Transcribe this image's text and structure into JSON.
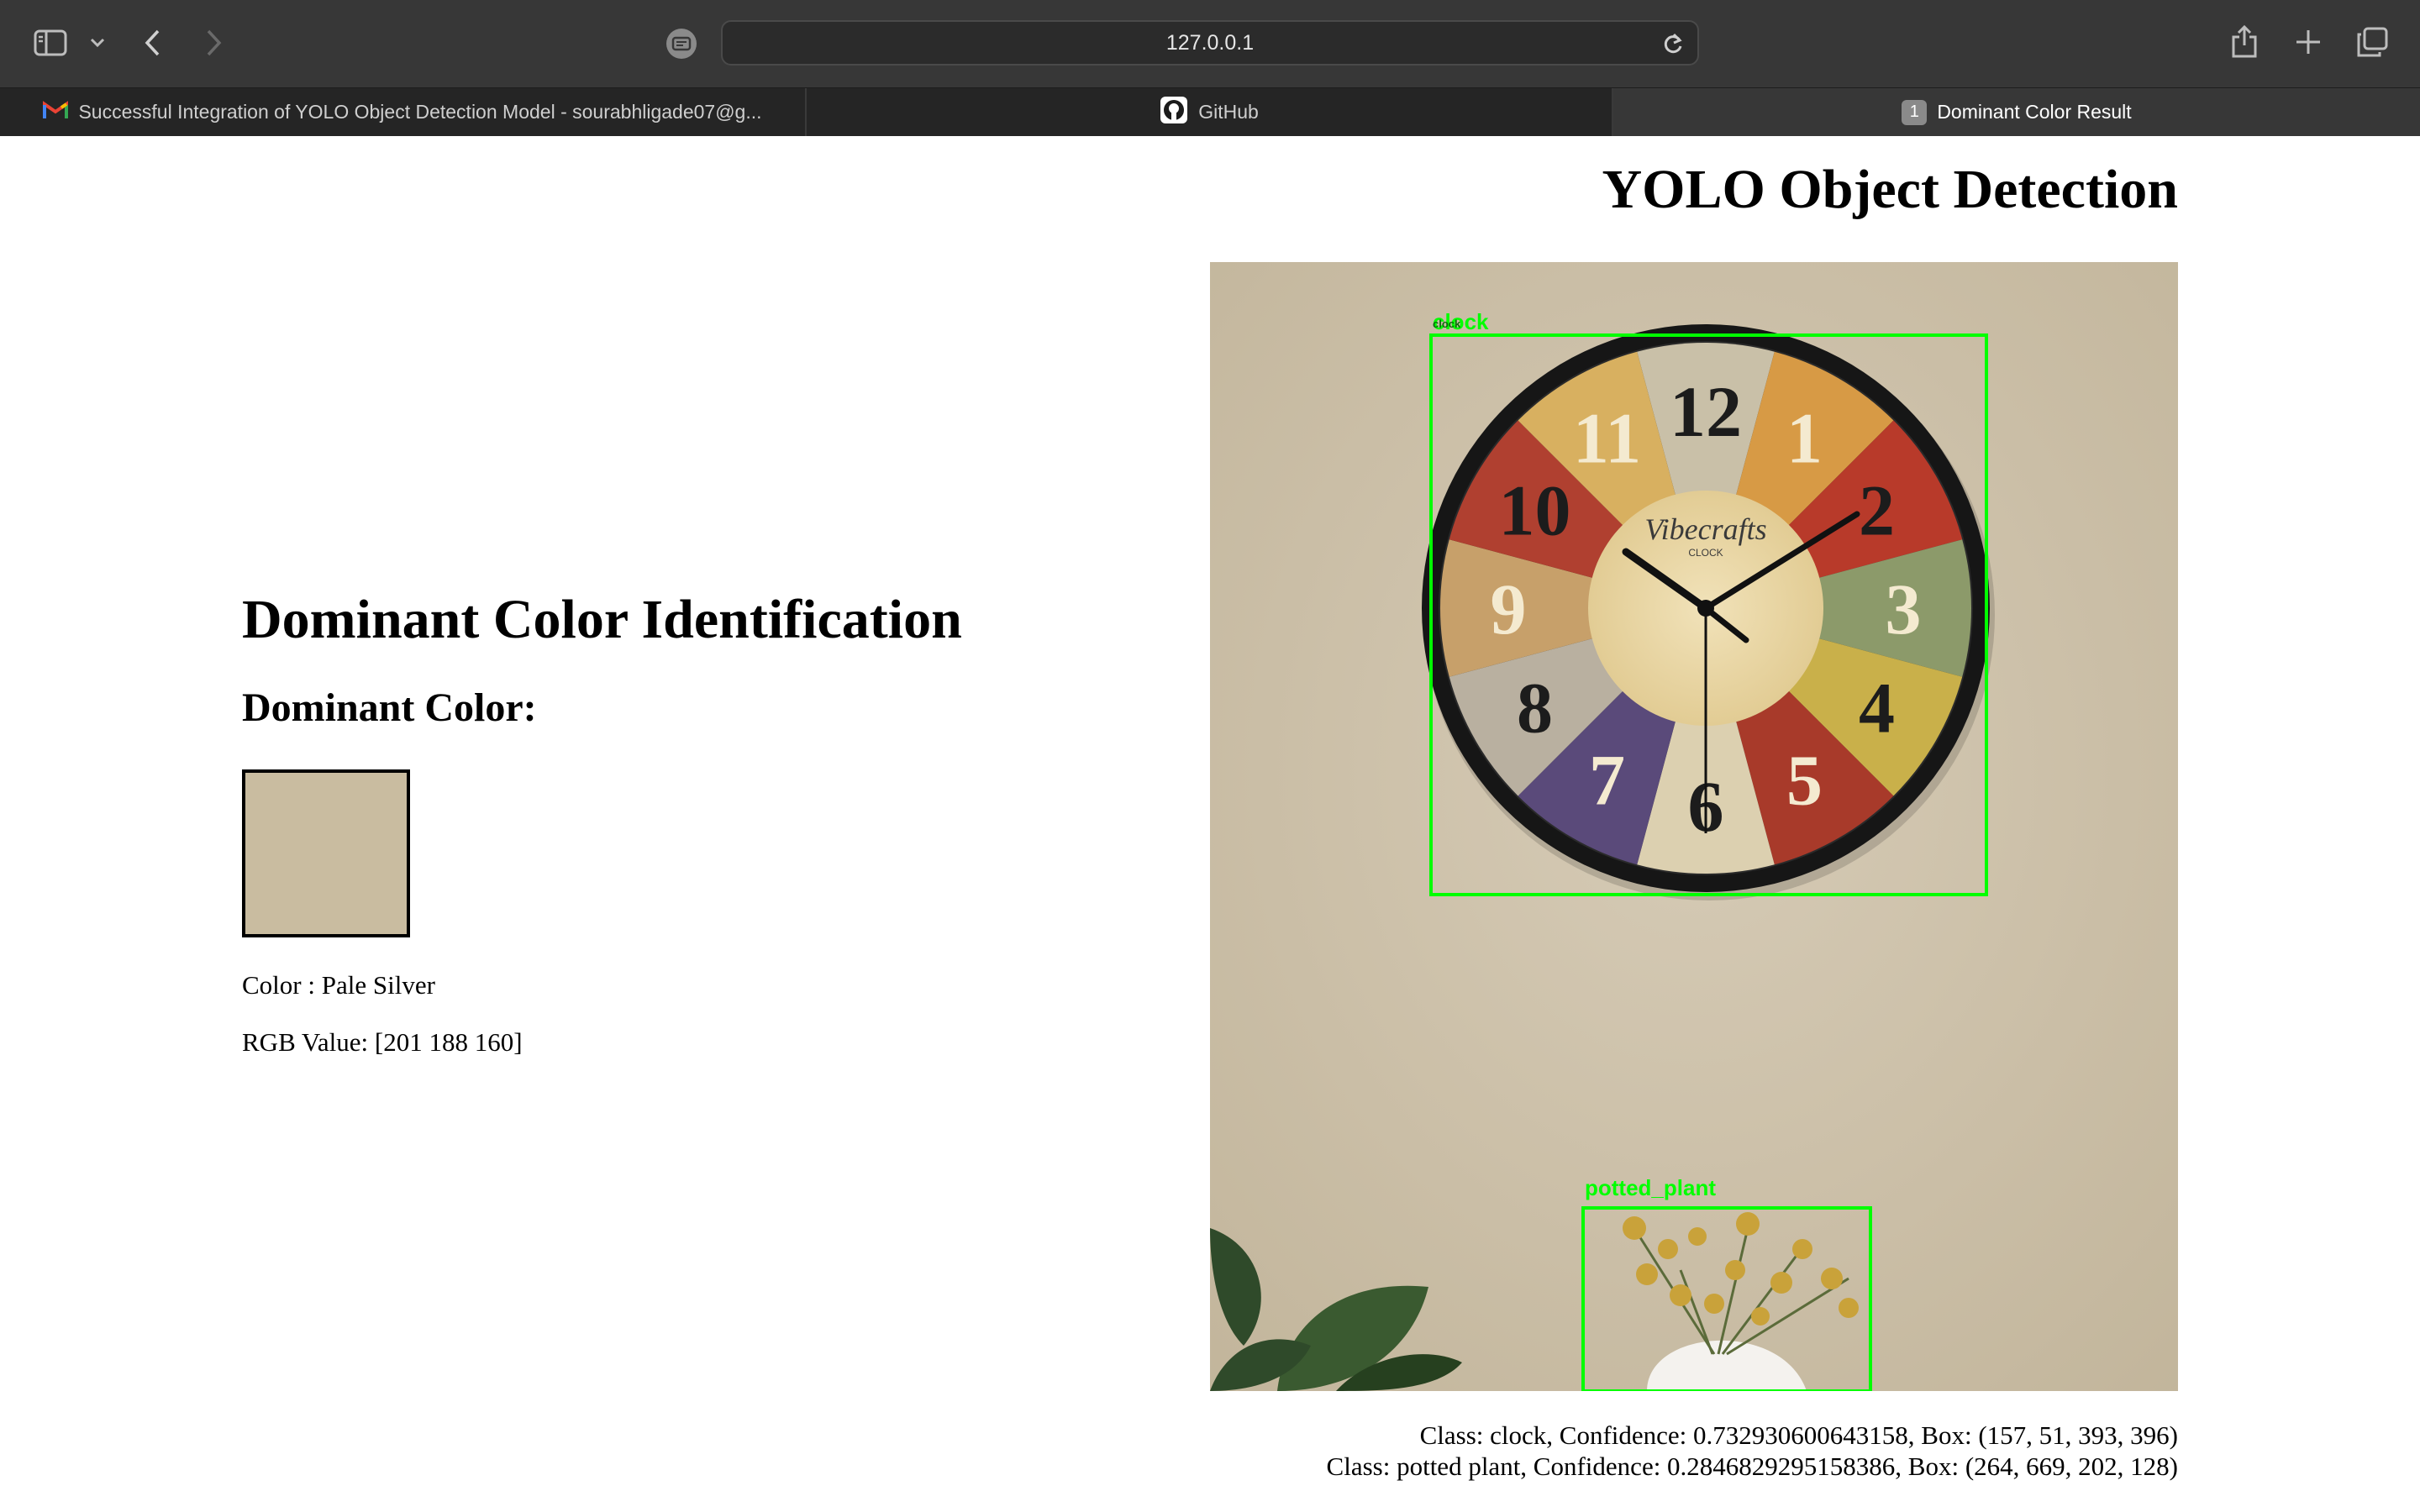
{
  "browser": {
    "url": "127.0.0.1",
    "tabs": [
      {
        "title": "Successful Integration of YOLO Object Detection Model - sourabhligade07@g...",
        "icon": "gmail-icon",
        "active": false
      },
      {
        "title": "GitHub",
        "icon": "github-icon",
        "active": false
      },
      {
        "title": "Dominant Color Result",
        "badge": "1",
        "active": true
      }
    ]
  },
  "yolo": {
    "title": "YOLO Object Detection",
    "box_labels": {
      "clock": "clock",
      "clock_small": "clock",
      "plant": "potted_plant"
    },
    "box_color": "#00ff00",
    "detections": [
      "Class: clock, Confidence: 0.732930600643158, Box: (157, 51, 393, 396)",
      "Class: potted plant, Confidence: 0.2846829295158386, Box: (264, 669, 202, 128)"
    ]
  },
  "clock_face": {
    "brand": "Vibecrafts",
    "brand_sub": "CLOCK",
    "numerals": [
      "12",
      "1",
      "2",
      "3",
      "4",
      "5",
      "6",
      "7",
      "8",
      "9",
      "10",
      "11"
    ]
  },
  "dominant": {
    "title": "Dominant Color Identification",
    "subtitle": "Dominant Color:",
    "color_hex": "#c9bca0",
    "color_line": "Color : Pale Silver",
    "rgb_line": "RGB Value: [201 188 160]"
  }
}
